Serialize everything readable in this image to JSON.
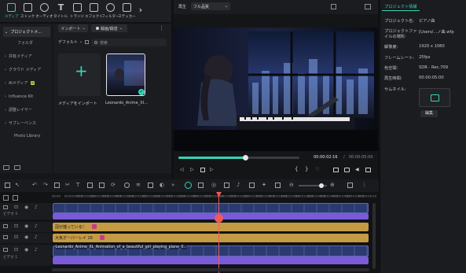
{
  "toolbar": {
    "items": [
      {
        "label": "メディア",
        "icon": "media-icon",
        "active": true
      },
      {
        "label": "ストック",
        "icon": "stock-icon"
      },
      {
        "label": "オーディオ",
        "icon": "audio-icon"
      },
      {
        "label": "タイトル",
        "icon": "title-icon"
      },
      {
        "label": "トランジ",
        "icon": "transition-icon"
      },
      {
        "label": "エフェクト",
        "icon": "effect-icon"
      },
      {
        "label": "フィルター",
        "icon": "filter-icon"
      },
      {
        "label": "ステッカー",
        "icon": "sticker-icon"
      }
    ],
    "more": "›"
  },
  "sidebar": {
    "items": [
      {
        "label": "プロジェクトメ...",
        "active": true
      },
      {
        "label": "フォルダ"
      },
      {
        "label": "共有メディア"
      },
      {
        "label": "クラウド メディア"
      },
      {
        "label": "AIメディア",
        "badge": "AI"
      },
      {
        "label": "Influence Kit"
      },
      {
        "label": "調整レイヤー"
      },
      {
        "label": "サブレーベンス"
      },
      {
        "label": "Photo Library"
      }
    ]
  },
  "media": {
    "import_button": "インポート",
    "record_button": "録画/録音",
    "sort_label": "デフォルト",
    "search_placeholder": "検索",
    "import_tile_label": "メディアをインポート",
    "clip_label": "Leonardo_Anime_XI..."
  },
  "player": {
    "mode": "再生",
    "quality": "フル品質",
    "current_time": "00:00:02:16",
    "total_time": "00:00:05:00",
    "progress_fraction": 0.55
  },
  "properties": {
    "tab": "プロジェクト情報",
    "rows": [
      {
        "label": "プロジェクト名:",
        "value": "ピアノ曲"
      },
      {
        "label": "プロジェクトファイルの場所:",
        "value": "[Users/...ノ曲.wfp"
      },
      {
        "label": "解像度:",
        "value": "1920 x 1080"
      },
      {
        "label": "フレームレート:",
        "value": "25fps"
      },
      {
        "label": "色空間:",
        "value": "SDR - Rec.709"
      },
      {
        "label": "再生時間:",
        "value": "00:00:05:00"
      },
      {
        "label": "サムネイル:",
        "value": ""
      }
    ],
    "edit_button": "編集"
  },
  "timeline": {
    "ruler_ticks": [
      "00:00",
      "00:00:00:05",
      "00:00:00:10",
      "00:00:00:15",
      "00:00:00:20",
      "00:00:01:00",
      "00:00:01:05",
      "00:00:01:10",
      "00:00:01:15",
      "00:00:01:20",
      "00:00:02:00",
      "00:00:02:05",
      "00:00:02:10",
      "00:00:02:15",
      "00:00:02:20",
      "00:00:03:00",
      "00:00:03:05",
      "00:00:03:10",
      "00:00:03:15",
      "00:00:03:20",
      "00:00:04:00",
      "00:00:04:05",
      "00:00:04:10",
      "00:00:04:15",
      "00:00:04:20"
    ],
    "track_labels": [
      "ビデオ 4",
      "ビデオ 3",
      "ビデオ 2",
      "ビデオ 1"
    ],
    "text_clip_1": "冠が揺っている！",
    "text_clip_2": "大気オーバーレイ 26",
    "video_clip": "Leonardo_Anime_XL_Animation_of_a_beautiful_girl_playing_piano_0..."
  }
}
